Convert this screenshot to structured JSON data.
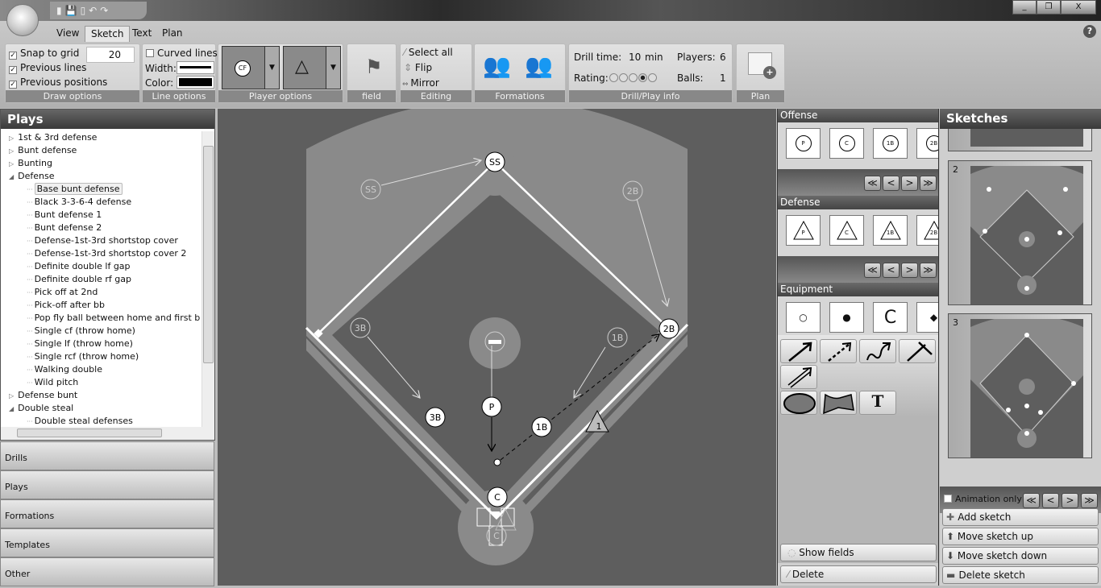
{
  "quick_access": {
    "icons": [
      "pin-icon",
      "save-icon",
      "new-icon",
      "undo-icon",
      "redo-icon"
    ]
  },
  "window": {
    "minimize": "_",
    "restore": "❐",
    "close": "X"
  },
  "tabs": [
    {
      "label": "View"
    },
    {
      "label": "Sketch",
      "active": true
    },
    {
      "label": "Text"
    },
    {
      "label": "Plan"
    }
  ],
  "help": "?",
  "ribbon": {
    "draw_options": {
      "label": "Draw options",
      "snap_to_grid": "Snap to grid",
      "snap_checked": true,
      "grid_value": "20",
      "previous_lines": "Previous lines",
      "previous_lines_checked": true,
      "previous_positions": "Previous positions",
      "previous_positions_checked": true
    },
    "line_options": {
      "label": "Line options",
      "curved_lines": "Curved lines",
      "curved_checked": false,
      "width_label": "Width:",
      "color_label": "Color:",
      "color": "#000000"
    },
    "player_options": {
      "label": "Player options",
      "offense_symbol": "CF",
      "defense_symbol": "CF"
    },
    "field": {
      "label": "field"
    },
    "editing": {
      "label": "Editing",
      "select_all": "Select all",
      "flip": "Flip",
      "mirror": "Mirror"
    },
    "formations": {
      "label": "Formations"
    },
    "info": {
      "label": "Drill/Play info",
      "drill_time_label": "Drill time:",
      "drill_time": "10",
      "drill_time_unit": "min",
      "players_label": "Players:",
      "players": "6",
      "rating_label": "Rating:",
      "rating": 4,
      "rating_max": 5,
      "balls_label": "Balls:",
      "balls": "1"
    },
    "plan": {
      "label": "Plan"
    }
  },
  "plays": {
    "title": "Plays",
    "items": [
      {
        "label": "1st & 3rd defense",
        "level": 0,
        "expander": "▷"
      },
      {
        "label": "Bunt defense",
        "level": 0,
        "expander": "▷"
      },
      {
        "label": "Bunting",
        "level": 0,
        "expander": "▷"
      },
      {
        "label": "Defense",
        "level": 0,
        "expander": "◢"
      },
      {
        "label": "Base bunt defense",
        "level": 1,
        "selected": true
      },
      {
        "label": "Black 3-3-6-4 defense",
        "level": 1
      },
      {
        "label": "Bunt defense 1",
        "level": 1
      },
      {
        "label": "Bunt defense 2",
        "level": 1
      },
      {
        "label": "Defense-1st-3rd shortstop cover",
        "level": 1
      },
      {
        "label": "Defense-1st-3rd shortstop cover 2",
        "level": 1
      },
      {
        "label": "Definite double lf gap",
        "level": 1
      },
      {
        "label": "Definite double rf gap",
        "level": 1
      },
      {
        "label": "Pick off at 2nd",
        "level": 1
      },
      {
        "label": "Pick-off after bb",
        "level": 1
      },
      {
        "label": "Pop fly ball between home and first base in",
        "level": 1
      },
      {
        "label": "Single cf (throw home)",
        "level": 1
      },
      {
        "label": "Single lf (throw home)",
        "level": 1
      },
      {
        "label": "Single rcf (throw home)",
        "level": 1
      },
      {
        "label": "Walking double",
        "level": 1
      },
      {
        "label": "Wild pitch",
        "level": 1
      },
      {
        "label": "Defense bunt",
        "level": 0,
        "expander": "▷"
      },
      {
        "label": "Double steal",
        "level": 0,
        "expander": "◢"
      },
      {
        "label": "Double steal defenses",
        "level": 1
      }
    ]
  },
  "nav": [
    {
      "label": "Drills"
    },
    {
      "label": "Plays"
    },
    {
      "label": "Formations"
    },
    {
      "label": "Templates"
    },
    {
      "label": "Other"
    }
  ],
  "field": {
    "players": [
      {
        "label": "SS"
      },
      {
        "label": "2B"
      },
      {
        "label": "3B"
      },
      {
        "label": "P"
      },
      {
        "label": "1B"
      },
      {
        "label": "C"
      }
    ],
    "ghosts": [
      {
        "label": "SS"
      },
      {
        "label": "2B"
      },
      {
        "label": "3B"
      },
      {
        "label": "1B"
      },
      {
        "label": "C"
      }
    ],
    "cone_label": "1"
  },
  "toolbox": {
    "offense": {
      "title": "Offense",
      "tiles": [
        "P",
        "C",
        "1B",
        "2B"
      ]
    },
    "defense": {
      "title": "Defense",
      "tiles": [
        "P",
        "C",
        "1B",
        "2B"
      ]
    },
    "equipment": {
      "title": "Equipment",
      "tiles": [
        "○",
        "●",
        "C",
        "◆"
      ]
    },
    "pager": [
      "≪",
      "<",
      ">",
      "≫"
    ],
    "tools": [
      "arrow-tool",
      "dashed-arrow-tool",
      "curvy-arrow-tool",
      "block-line-tool",
      "double-arrow-tool",
      "ellipse-tool",
      "polygon-tool",
      "text-tool"
    ],
    "text_tool": "T",
    "show_fields": "Show fields",
    "delete": "Delete"
  },
  "sketches": {
    "title": "Sketches",
    "items": [
      {
        "number": "2"
      },
      {
        "number": "3"
      }
    ],
    "animation_only": "Animation only",
    "animation_checked": false,
    "add": "Add sketch",
    "move_up": "Move sketch up",
    "move_down": "Move sketch down",
    "delete": "Delete sketch"
  }
}
